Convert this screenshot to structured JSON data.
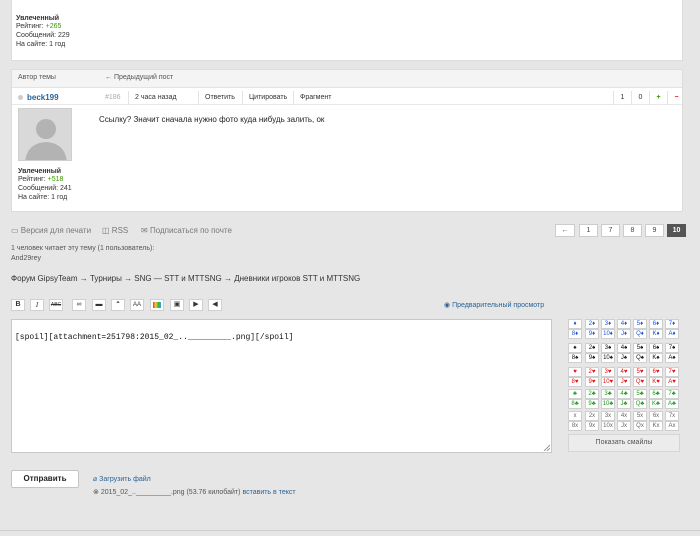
{
  "post1": {
    "stats": {
      "rank": "Увлеченный",
      "rating_label": "Рейтинг:",
      "rating_value": "+265",
      "messages": "Сообщений: 229",
      "online": "На сайте: 1 год"
    }
  },
  "post2": {
    "author_label": "Автор темы",
    "prev_post": "← Предыдущий пост",
    "username": "beck199",
    "post_number": "#186",
    "time": "2 часа назад",
    "reply": "Ответить",
    "quote": "Цитировать",
    "fragment": "Фрагмент",
    "vote_up_count": "1",
    "vote_down_count": "0",
    "plus": "+",
    "minus": "−",
    "text": "Ссылку? Значит сначала нужно фото куда нибудь залить, ок",
    "stats": {
      "rank": "Увлеченный",
      "rating_label": "Рейтинг:",
      "rating_value": "+518",
      "messages": "Сообщений: 241",
      "online": "На сайте: 1 год"
    }
  },
  "tools": {
    "print": "Версия для печати",
    "rss": "RSS",
    "subscribe": "Подписаться по почте"
  },
  "pager": {
    "prev": "←",
    "pages": [
      "1",
      "7",
      "8",
      "9",
      "10"
    ],
    "active": "10"
  },
  "readers": {
    "line1": "1 человек читает эту тему (1 пользователь):",
    "line2": "And29rey"
  },
  "breadcrumbs": "Форум GipsyTeam → Турниры → SNG — STT и MTTSNG → Дневники игроков STT и MTTSNG",
  "toolbar": {
    "bold": "B",
    "italic": "I",
    "strike": "ABC",
    "quote": "“",
    "font": "AA",
    "preview": "Предварительный просмотр"
  },
  "editor": {
    "value": "[spoil][attachment=251798:2015_02_.._________.png][/spoil]"
  },
  "smilies": {
    "rows": [
      [
        "♦",
        "2♦",
        "3♦",
        "4♦",
        "5♦",
        "6♦",
        "7♦"
      ],
      [
        "8♦",
        "9♦",
        "10♦",
        "J♦",
        "Q♦",
        "K♦",
        "A♦"
      ],
      [
        "♠",
        "2♠",
        "3♠",
        "4♠",
        "5♠",
        "6♠",
        "7♠"
      ],
      [
        "8♠",
        "9♠",
        "10♠",
        "J♠",
        "Q♠",
        "K♠",
        "A♠"
      ],
      [
        "♥",
        "2♥",
        "3♥",
        "4♥",
        "5♥",
        "6♥",
        "7♥"
      ],
      [
        "8♥",
        "9♥",
        "10♥",
        "J♥",
        "Q♥",
        "K♥",
        "A♥"
      ],
      [
        "♣",
        "2♣",
        "3♣",
        "4♣",
        "5♣",
        "6♣",
        "7♣"
      ],
      [
        "8♣",
        "9♣",
        "10♣",
        "J♣",
        "Q♣",
        "K♣",
        "A♣"
      ],
      [
        "x",
        "2x",
        "3x",
        "4x",
        "5x",
        "6x",
        "7x"
      ],
      [
        "8x",
        "9x",
        "10x",
        "Jx",
        "Qx",
        "Kx",
        "Ax"
      ]
    ],
    "show": "Показать смайлы"
  },
  "form": {
    "send": "Отправить",
    "upload": "Загрузить файл",
    "attachment_name": "2015_02_.._________.png (53.76 килобайт)",
    "insert": "вставить в текст"
  },
  "colors": {
    "diamonds": "#1a4fd6",
    "spades": "#111111",
    "hearts": "#dd1111",
    "clubs": "#1c9a1c",
    "plain": "#666666",
    "link": "#2a6496",
    "rating_positive": "#3a9a00"
  }
}
